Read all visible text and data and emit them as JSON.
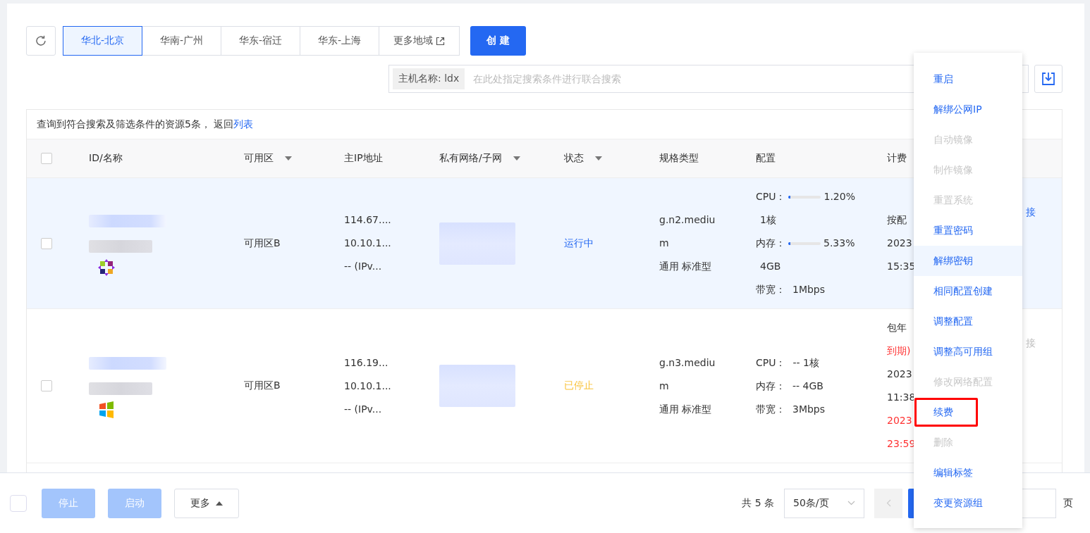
{
  "toolbar": {
    "regions": [
      {
        "label": "华北-北京",
        "selected": true,
        "external": false
      },
      {
        "label": "华南-广州",
        "selected": false,
        "external": false
      },
      {
        "label": "华东-宿迁",
        "selected": false,
        "external": false
      },
      {
        "label": "华东-上海",
        "selected": false,
        "external": false
      },
      {
        "label": "更多地域",
        "selected": false,
        "external": true
      }
    ],
    "create_button": "创 建"
  },
  "search": {
    "tag": "主机名称: ldx",
    "placeholder": "在此处指定搜索条件进行联合搜索"
  },
  "result_info": {
    "text": "查询到符合搜索及筛选条件的资源5条， 返回",
    "link": "列表"
  },
  "table": {
    "select_all": false,
    "columns": [
      {
        "label": "ID/名称",
        "filter": false
      },
      {
        "label": "可用区",
        "filter": true
      },
      {
        "label": "主IP地址",
        "filter": false
      },
      {
        "label": "私有网络/子网",
        "filter": true
      },
      {
        "label": "状态",
        "filter": true
      },
      {
        "label": "规格类型",
        "filter": false
      },
      {
        "label": "配置",
        "filter": false
      },
      {
        "label": "计费",
        "filter": false
      }
    ],
    "rows": [
      {
        "checked": false,
        "highlighted": true,
        "os_logo": {
          "kind": "flower"
        },
        "zone": "可用区B",
        "ip": [
          "114.67....",
          "10.10.1...",
          "--  (IPv..."
        ],
        "status": {
          "kind": "running",
          "label": "运行中"
        },
        "spec": [
          "g.n2.mediu",
          "m",
          "通用 标准型"
        ],
        "config": [
          {
            "kind": "meter",
            "label": "CPU：",
            "level": 0.012,
            "reading": "1.20%"
          },
          {
            "kind": "plain",
            "text": "1核"
          },
          {
            "kind": "meter",
            "label": "内存：",
            "level": 0.0533,
            "reading": "5.33%"
          },
          {
            "kind": "plain",
            "text": "4GB"
          },
          {
            "kind": "pair",
            "label": "带宽：",
            "value": "1Mbps"
          }
        ],
        "billing": [
          {
            "text": "按配",
            "alert": false
          },
          {
            "text": "2023",
            "alert": false
          },
          {
            "text": "15:35",
            "alert": false
          }
        ],
        "action": {
          "label": "接",
          "disabled": false
        }
      },
      {
        "checked": false,
        "highlighted": false,
        "os_logo": {
          "kind": "windows"
        },
        "zone": "可用区B",
        "ip": [
          "116.19...",
          "10.10.1...",
          "--  (IPv..."
        ],
        "status": {
          "kind": "stopped",
          "label": "已停止"
        },
        "spec": [
          "g.n3.mediu",
          "m",
          "通用 标准型"
        ],
        "config": [
          {
            "kind": "pair",
            "label": "CPU：",
            "value": "--  1核"
          },
          {
            "kind": "pair",
            "label": "内存：",
            "value": "--  4GB"
          },
          {
            "kind": "pair",
            "label": "带宽：",
            "value": "3Mbps"
          }
        ],
        "billing": [
          {
            "text": "包年",
            "alert": false
          },
          {
            "text": "到期)",
            "alert": true
          },
          {
            "text": "2023",
            "alert": false
          },
          {
            "text": "11:38",
            "alert": false
          },
          {
            "text": "2023",
            "alert": true
          },
          {
            "text": "23:59",
            "alert": true
          }
        ],
        "action": {
          "label": "接",
          "disabled": true
        }
      }
    ]
  },
  "footer": {
    "checked": false,
    "buttons": [
      {
        "label": "停止",
        "kind": "primary",
        "disabled": true
      },
      {
        "label": "启动",
        "kind": "primary",
        "disabled": true
      },
      {
        "label": "更多",
        "kind": "dropdown",
        "disabled": false
      }
    ],
    "total": "共 5 条",
    "page_size": "50条/页",
    "page_unit": "页"
  },
  "menu": {
    "items": [
      {
        "label": "重启",
        "disabled": false,
        "highlighted": false,
        "marked": false
      },
      {
        "label": "解绑公网IP",
        "disabled": false,
        "highlighted": false,
        "marked": false
      },
      {
        "label": "自动镜像",
        "disabled": true,
        "highlighted": false,
        "marked": false
      },
      {
        "label": "制作镜像",
        "disabled": true,
        "highlighted": false,
        "marked": false
      },
      {
        "label": "重置系统",
        "disabled": true,
        "highlighted": false,
        "marked": false
      },
      {
        "label": "重置密码",
        "disabled": false,
        "highlighted": false,
        "marked": false
      },
      {
        "label": "解绑密钥",
        "disabled": false,
        "highlighted": true,
        "marked": false
      },
      {
        "label": "相同配置创建",
        "disabled": false,
        "highlighted": false,
        "marked": false
      },
      {
        "label": "调整配置",
        "disabled": false,
        "highlighted": false,
        "marked": false
      },
      {
        "label": "调整高可用组",
        "disabled": false,
        "highlighted": false,
        "marked": false
      },
      {
        "label": "修改网络配置",
        "disabled": true,
        "highlighted": false,
        "marked": false
      },
      {
        "label": "续费",
        "disabled": false,
        "highlighted": false,
        "marked": true
      },
      {
        "label": "删除",
        "disabled": true,
        "highlighted": false,
        "marked": false
      },
      {
        "label": "编辑标签",
        "disabled": false,
        "highlighted": false,
        "marked": false
      },
      {
        "label": "变更资源组",
        "disabled": false,
        "highlighted": false,
        "marked": false
      }
    ]
  }
}
